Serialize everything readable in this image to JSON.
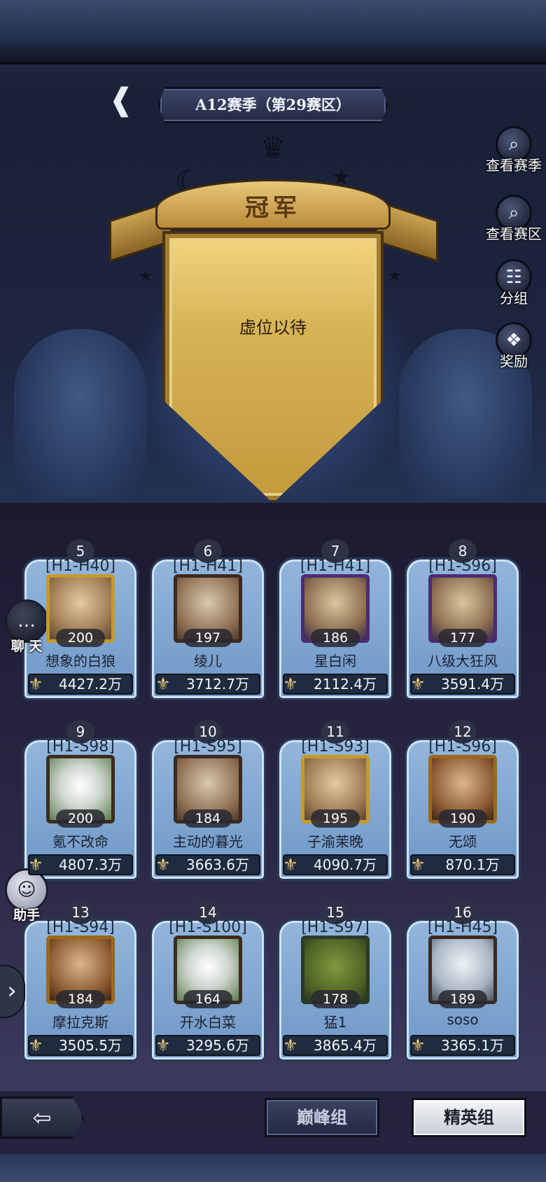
{
  "header": {
    "season_title": "A12赛季（第29赛区）"
  },
  "champion": {
    "banner_label": "冠军",
    "vacant_text": "虚位以待"
  },
  "side_menu": [
    {
      "label": "查看赛季",
      "icon": "magnifier-icon"
    },
    {
      "label": "查看赛区",
      "icon": "magnifier-icon"
    },
    {
      "label": "分组",
      "icon": "bracket-icon"
    },
    {
      "label": "奖励",
      "icon": "gift-icon"
    }
  ],
  "floating": {
    "chat_label": "聊 天",
    "assistant_label": "助手"
  },
  "players": [
    {
      "rank": "5",
      "server": "[H1-H40]",
      "level": "200",
      "name": "想象的白狼",
      "power": "4427.2万",
      "frame": "gold"
    },
    {
      "rank": "6",
      "server": "[H1-H41]",
      "level": "197",
      "name": "绫儿",
      "power": "3712.7万",
      "frame": "default"
    },
    {
      "rank": "7",
      "server": "[H1-H41]",
      "level": "186",
      "name": "星白闲",
      "power": "2112.4万",
      "frame": "purple"
    },
    {
      "rank": "8",
      "server": "[H1-S96]",
      "level": "177",
      "name": "八级大狂风",
      "power": "3591.4万",
      "frame": "purple"
    },
    {
      "rank": "9",
      "server": "[H1-S98]",
      "level": "200",
      "name": "氪不改命",
      "power": "4807.3万",
      "frame": "leaf"
    },
    {
      "rank": "10",
      "server": "[H1-S95]",
      "level": "184",
      "name": "主动的暮光",
      "power": "3663.6万",
      "frame": "default"
    },
    {
      "rank": "11",
      "server": "[H1-S93]",
      "level": "195",
      "name": "子渝茉晚",
      "power": "4090.7万",
      "frame": "gold"
    },
    {
      "rank": "12",
      "server": "[H1-S96]",
      "level": "190",
      "name": "无颂",
      "power": "870.1万",
      "frame": "vip"
    },
    {
      "rank": "13",
      "server": "[H1-S94]",
      "level": "184",
      "name": "摩拉克斯",
      "power": "3505.5万",
      "frame": "vip"
    },
    {
      "rank": "14",
      "server": "[H1-S100]",
      "level": "164",
      "name": "开水白菜",
      "power": "3295.6万",
      "frame": "leaf"
    },
    {
      "rank": "15",
      "server": "[H1-S97]",
      "level": "178",
      "name": "猛1",
      "power": "3865.4万",
      "frame": "green"
    },
    {
      "rank": "16",
      "server": "[H1-H45]",
      "level": "189",
      "name": "soso",
      "power": "3365.1万",
      "frame": "white"
    }
  ],
  "tabs": {
    "peak_label": "巅峰组",
    "elite_label": "精英组",
    "selected": "精英组"
  },
  "colors": {
    "gold": "#d7b356",
    "card_blue": "#93b6dc",
    "power_bar": "#1f2b3e"
  }
}
